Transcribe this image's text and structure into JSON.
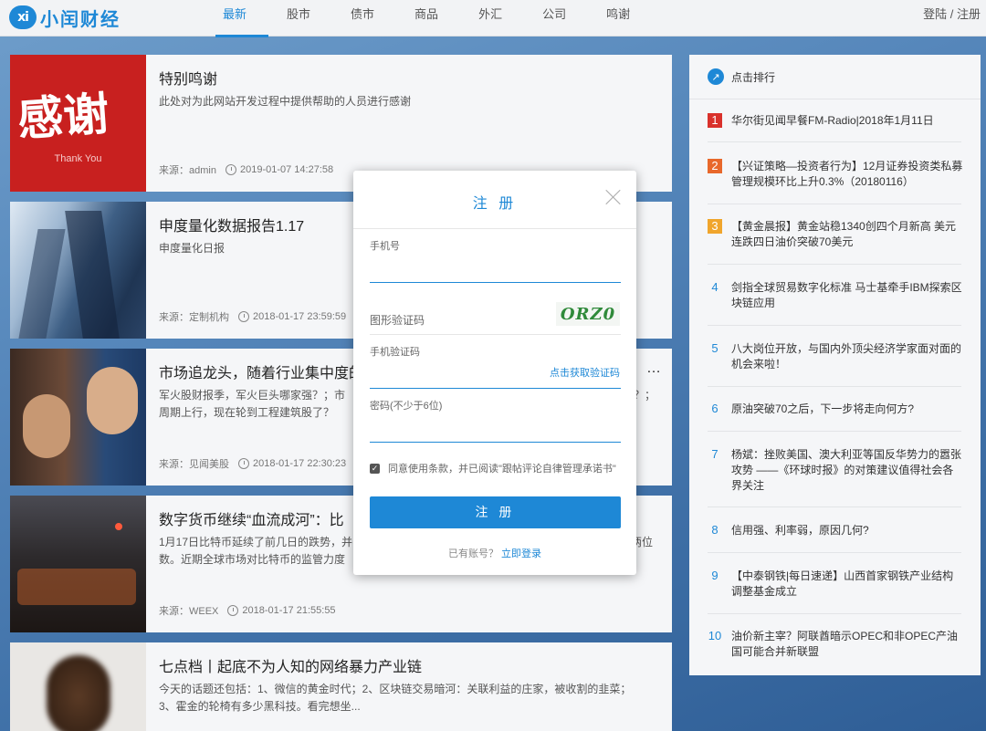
{
  "header": {
    "logo_mark": "xi",
    "logo_text": "小闰财经",
    "nav": [
      "最新",
      "股市",
      "债市",
      "商品",
      "外汇",
      "公司",
      "鸣谢"
    ],
    "auth": "登陆 / 注册"
  },
  "articles": [
    {
      "title": "特别鸣谢",
      "desc": "此处对为此网站开发过程中提供帮助的人员进行感谢",
      "source": "来源：admin",
      "time": "2019-01-07 14:27:58",
      "thumb": {
        "big_text": "感谢",
        "sub_text": "Thank You"
      }
    },
    {
      "title": "申度量化数据报告1.17",
      "desc": "申度量化日报",
      "source": "来源：定制机构",
      "time": "2018-01-17 23:59:59"
    },
    {
      "title": "市场追龙头，随着行业集中度的",
      "title_tail": "…",
      "desc": "军火股财报季，军火巨头哪家强？；市",
      "desc_tail": "？；",
      "desc2": "周期上行，现在轮到工程建筑股了？",
      "source": "来源：见闻美股",
      "time": "2018-01-17 22:30:23"
    },
    {
      "title": "数字货币继续“血流成河”：比",
      "desc": "1月17日比特币延续了前几日的跌势，并",
      "desc_tail": "两位",
      "desc2": "数。近期全球市场对比特币的监管力度",
      "source": "来源：WEEX",
      "time": "2018-01-17 21:55:55"
    },
    {
      "title": "七点档丨起底不为人知的网络暴力产业链",
      "desc": "今天的话题还包括：1、微信的黄金时代；2、区块链交易暗河：关联利益的庄家，被收割的韭菜；",
      "desc2": "3、霍金的轮椅有多少黑科技。看完想坐..."
    }
  ],
  "sidebar": {
    "title": "点击排行",
    "items": [
      {
        "num": "1",
        "text": "华尔街见闻早餐FM-Radio|2018年1月11日"
      },
      {
        "num": "2",
        "text": "【兴证策略—投资者行为】12月证券投资类私募管理规模环比上升0.3%（20180116）"
      },
      {
        "num": "3",
        "text": "【黄金晨报】黄金站稳1340创四个月新高 美元连跌四日油价突破70美元"
      },
      {
        "num": "4",
        "text": "剑指全球贸易数字化标准 马士基牵手IBM探索区块链应用"
      },
      {
        "num": "5",
        "text": "八大岗位开放，与国内外顶尖经济学家面对面的机会来啦！"
      },
      {
        "num": "6",
        "text": "原油突破70之后，下一步将走向何方?"
      },
      {
        "num": "7",
        "text": "杨斌：挫败美国、澳大利亚等国反华势力的嚣张攻势 ——《环球时报》的对策建议值得社会各界关注"
      },
      {
        "num": "8",
        "text": "信用强、利率弱，原因几何?"
      },
      {
        "num": "9",
        "text": "【中泰钢铁|每日速递】山西首家钢铁产业结构调整基金成立"
      },
      {
        "num": "10",
        "text": "油价新主宰？阿联酋暗示OPEC和非OPEC产油国可能合并新联盟"
      }
    ]
  },
  "modal": {
    "title": "注 册",
    "phone_label": "手机号",
    "captcha_label": "图形验证码",
    "captcha_text": "ORZ0",
    "sms_label": "手机验证码",
    "sms_link": "点击获取验证码",
    "password_label": "密码(不少于6位)",
    "agree_text": "同意使用条款，并已阅读\"跟帖评论自律管理承诺书\"",
    "submit": "注 册",
    "footer_text": "已有账号？",
    "login_link": "立即登录"
  },
  "colors": {
    "accent": "#1e88d6",
    "rank1": "#d9312b",
    "rank2": "#e8682b",
    "rank3": "#f0a52c"
  }
}
